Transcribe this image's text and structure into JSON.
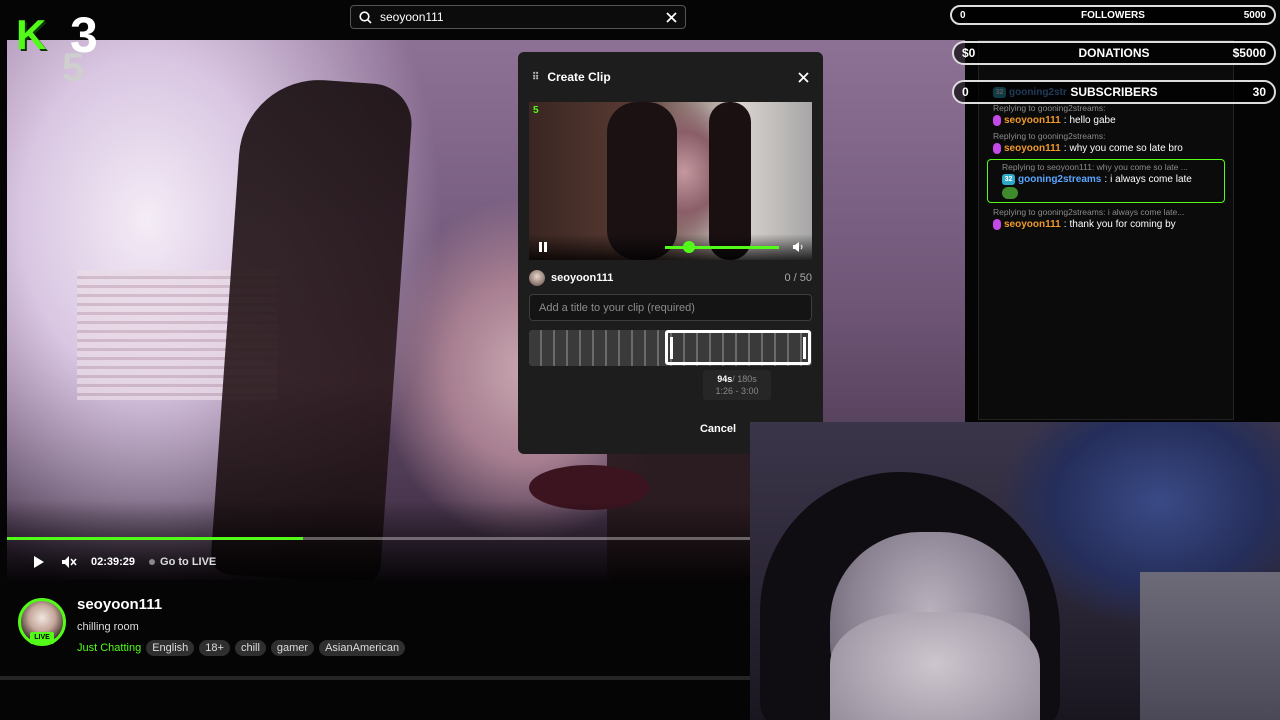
{
  "search": {
    "value": "seoyoon111"
  },
  "logo": {
    "k": "K",
    "n3": "3",
    "n5": "5"
  },
  "overlay": {
    "followers": {
      "left": "0",
      "label": "FOLLOWERS",
      "right": "5000"
    },
    "donations": {
      "left": "$0",
      "label": "DONATIONS",
      "right": "$5000"
    },
    "subscribers": {
      "left": "0",
      "label": "SUBSCRIBERS",
      "right": "30"
    }
  },
  "player": {
    "time": "02:39:29",
    "go_live": "Go to LIVE",
    "progress_fraction": 0.397
  },
  "chat": {
    "messages": [
      {
        "reply": "",
        "user": "gooning2str",
        "text": ""
      },
      {
        "reply": "Replying to gooning2streams:",
        "user": "seoyoon111",
        "text": "hello gabe"
      },
      {
        "reply": "Replying to gooning2streams:",
        "user": "seoyoon111",
        "text": "why you come so late bro"
      },
      {
        "reply": "Replying to seoyoon111: why you come so late ...",
        "user": "gooning2streams",
        "text": "i always come late"
      },
      {
        "reply": "Replying to gooning2streams: i always come late...",
        "user": "seoyoon111",
        "text": "thank you for coming by"
      }
    ],
    "sub_badge": "32"
  },
  "modal": {
    "title": "Create Clip",
    "username": "seoyoon111",
    "char_count": "0 / 50",
    "title_placeholder": "Add a title to your clip (required)",
    "title_value": "",
    "duration": "94s",
    "duration_max": "/ 180s",
    "range": "1:26 - 3:00",
    "cancel_label": "Cancel",
    "preview_badge": "5"
  },
  "stream": {
    "channel": "seoyoon111",
    "live": "LIVE",
    "title": "chilling room",
    "category": "Just Chatting",
    "tags": [
      "English",
      "18+",
      "chill",
      "gamer",
      "AsianAmerican"
    ]
  },
  "colors": {
    "accent": "#53fc18",
    "mic_badge": "#c34ae8",
    "sub_badge": "#2fa9c9",
    "user_orange": "#f19a2a",
    "user_blue": "#5aa6ff"
  }
}
